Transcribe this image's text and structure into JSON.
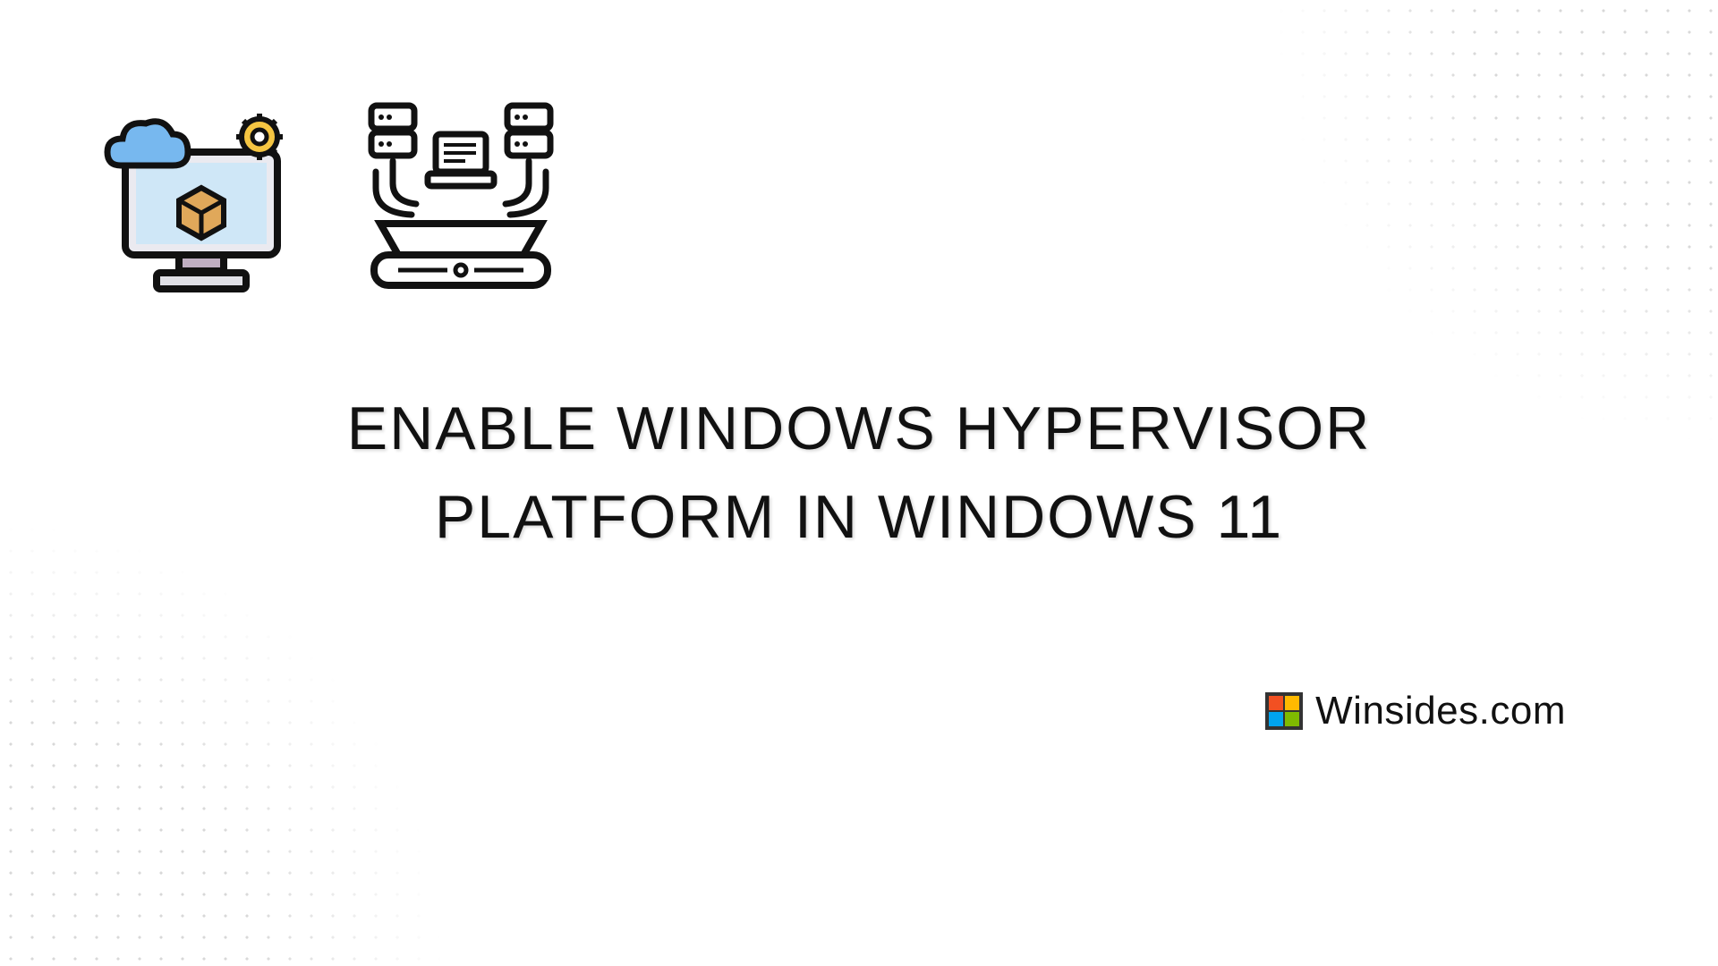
{
  "headline": "ENABLE WINDOWS HYPERVISOR\nPLATFORM IN WINDOWS 11",
  "brand": {
    "name": "Winsides.com"
  },
  "icons": {
    "left": "cloud-computer-icon",
    "right": "server-platform-icon"
  },
  "logo_colors": {
    "q1": "#f25022",
    "q2": "#ffb900",
    "q3": "#00a4ef",
    "q4": "#7fba00"
  }
}
